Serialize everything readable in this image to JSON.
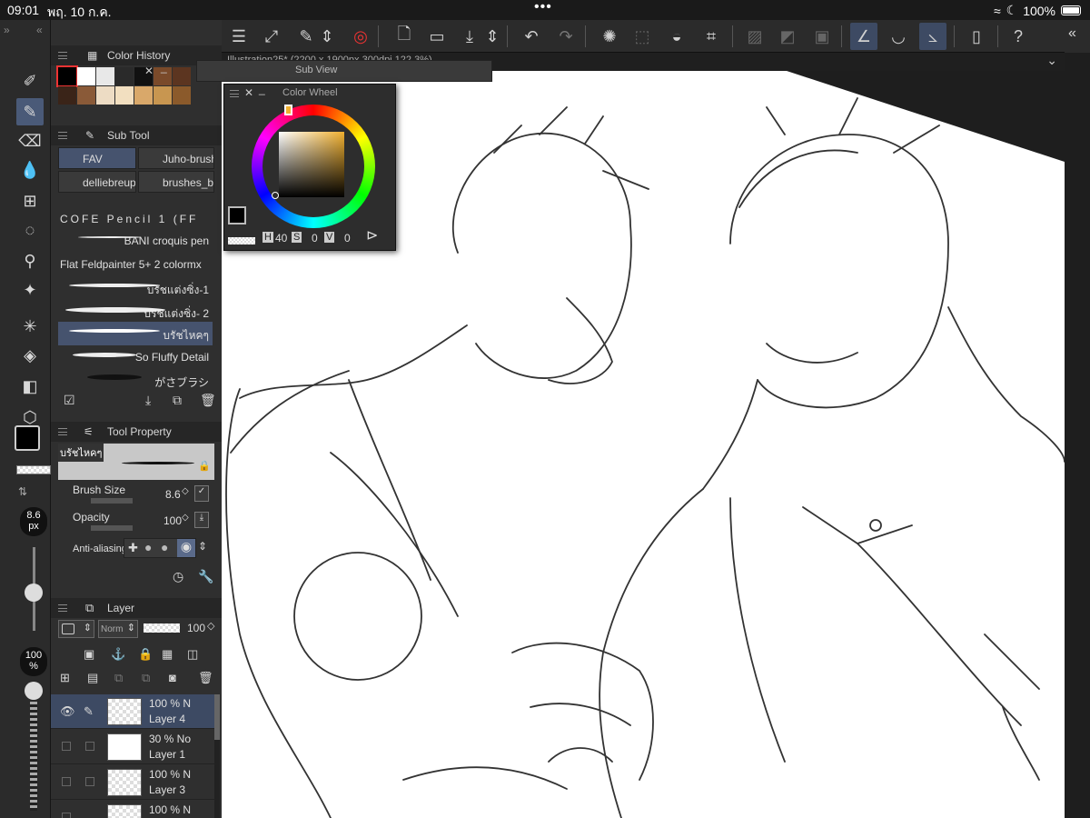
{
  "status": {
    "time": "09:01",
    "date": "พฤ. 10 ก.ค.",
    "battery": "100%"
  },
  "toolbar": {
    "menu_label": "menu",
    "doc_tab_label": "Illustration25* (2200 x 1900px 300dpi 122.3%)"
  },
  "color_history": {
    "title": "Color History",
    "swatches": [
      "#000000",
      "#ffffff",
      "#e8e8e8",
      "#2a2a2a",
      "#111111",
      "#7a4a2a",
      "#5c3520",
      "#3a2418",
      "#8a5a38",
      "#eddcc4",
      "#f2dfc0",
      "#d9a86a",
      "#c89650",
      "#8b5a2b"
    ]
  },
  "subview": {
    "title": "Sub View"
  },
  "color_wheel": {
    "title": "Color Wheel",
    "h_label": "H",
    "h_value": "40",
    "s_label": "S",
    "s_value": "0",
    "v_label": "V",
    "v_value": "0",
    "accent": "#f0b030"
  },
  "sub_tool": {
    "title": "Sub Tool",
    "tabs": [
      "FAV",
      "Juho-brush",
      "delliebreup",
      "brushes_by"
    ],
    "brushes": [
      {
        "name": "COFE Pencil 1 (FF"
      },
      {
        "name": "BANI croquis pen"
      },
      {
        "name": "Flat Feldpainter 5+ 2 colormx"
      },
      {
        "name": "บรัชแต่งซิ่ง-1"
      },
      {
        "name": "บรัชแต่งซิ่ง- 2"
      },
      {
        "name": "บรัชไหคๆ"
      },
      {
        "name": "So Fluffy Detail"
      },
      {
        "name": "がさブラシ"
      }
    ]
  },
  "tool_property": {
    "title": "Tool Property",
    "brush_name": "บรัชไหคๆ",
    "brush_size_label": "Brush Size",
    "brush_size_value": "8.6",
    "opacity_label": "Opacity",
    "opacity_value": "100",
    "antialias_label": "Anti-aliasing"
  },
  "left_strip": {
    "size_value": "8.6",
    "size_unit": "px",
    "opacity_value": "100",
    "opacity_unit": "%"
  },
  "layer": {
    "title": "Layer",
    "blend_mode": "Norm",
    "opacity": "100",
    "rows": [
      {
        "pct": "100 % N",
        "name": "Layer 4"
      },
      {
        "pct": "30 % No",
        "name": "Layer 1"
      },
      {
        "pct": "100 % N",
        "name": "Layer 3"
      },
      {
        "pct": "100 % N",
        "name": ""
      }
    ]
  }
}
